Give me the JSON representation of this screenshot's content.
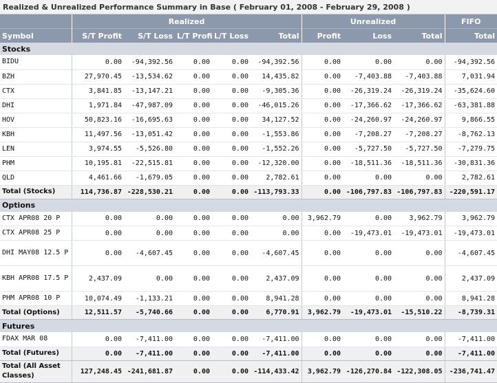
{
  "title": "Realized & Unrealized Performance Summary in Base ( February 01, 2008 - February 29, 2008 )",
  "group_headers": {
    "realized": "Realized",
    "unrealized": "Unrealized",
    "fifo": "FIFO"
  },
  "column_headers": {
    "symbol": "Symbol",
    "st_profit": "S/T Profit",
    "st_loss": "S/T Loss",
    "lt_profit": "L/T Profit",
    "lt_loss": "L/T Loss",
    "realized_total": "Total",
    "profit": "Profit",
    "loss": "Loss",
    "unrealized_total": "Total",
    "fifo_total": "Total"
  },
  "sections": {
    "stocks": {
      "label": "Stocks",
      "rows": [
        {
          "symbol": "BIDU",
          "v": [
            "0.00",
            "-94,392.56",
            "0.00",
            "0.00",
            "-94,392.56",
            "0.00",
            "0.00",
            "0.00",
            "-94,392.56"
          ]
        },
        {
          "symbol": "BZH",
          "v": [
            "27,970.45",
            "-13,534.62",
            "0.00",
            "0.00",
            "14,435.82",
            "0.00",
            "-7,403.88",
            "-7,403.88",
            "7,031.94"
          ]
        },
        {
          "symbol": "CTX",
          "v": [
            "3,841.85",
            "-13,147.21",
            "0.00",
            "0.00",
            "-9,305.36",
            "0.00",
            "-26,319.24",
            "-26,319.24",
            "-35,624.60"
          ]
        },
        {
          "symbol": "DHI",
          "v": [
            "1,971.84",
            "-47,987.09",
            "0.00",
            "0.00",
            "-46,015.26",
            "0.00",
            "-17,366.62",
            "-17,366.62",
            "-63,381.88"
          ]
        },
        {
          "symbol": "HOV",
          "v": [
            "50,823.16",
            "-16,695.63",
            "0.00",
            "0.00",
            "34,127.52",
            "0.00",
            "-24,260.97",
            "-24,260.97",
            "9,866.55"
          ]
        },
        {
          "symbol": "KBH",
          "v": [
            "11,497.56",
            "-13,051.42",
            "0.00",
            "0.00",
            "-1,553.86",
            "0.00",
            "-7,208.27",
            "-7,208.27",
            "-8,762.13"
          ]
        },
        {
          "symbol": "LEN",
          "v": [
            "3,974.55",
            "-5,526.80",
            "0.00",
            "0.00",
            "-1,552.26",
            "0.00",
            "-5,727.50",
            "-5,727.50",
            "-7,279.75"
          ]
        },
        {
          "symbol": "PHM",
          "v": [
            "10,195.81",
            "-22,515.81",
            "0.00",
            "0.00",
            "-12,320.00",
            "0.00",
            "-18,511.36",
            "-18,511.36",
            "-30,831.36"
          ]
        },
        {
          "symbol": "QLD",
          "v": [
            "4,461.66",
            "-1,679.05",
            "0.00",
            "0.00",
            "2,782.61",
            "0.00",
            "0.00",
            "0.00",
            "2,782.61"
          ]
        }
      ],
      "total": {
        "label": "Total (Stocks)",
        "v": [
          "114,736.87",
          "-228,530.21",
          "0.00",
          "0.00",
          "-113,793.33",
          "0.00",
          "-106,797.83",
          "-106,797.83",
          "-220,591.17"
        ]
      }
    },
    "options": {
      "label": "Options",
      "rows": [
        {
          "symbol": "CTX APR08 20 P",
          "v": [
            "0.00",
            "0.00",
            "0.00",
            "0.00",
            "0.00",
            "3,962.79",
            "0.00",
            "3,962.79",
            "3,962.79"
          ]
        },
        {
          "symbol": "CTX APR08 25 P",
          "v": [
            "0.00",
            "0.00",
            "0.00",
            "0.00",
            "0.00",
            "0.00",
            "-19,473.01",
            "-19,473.01",
            "-19,473.01"
          ]
        },
        {
          "symbol": "DHI MAY08 12.5 P",
          "v": [
            "0.00",
            "-4,607.45",
            "0.00",
            "0.00",
            "-4,607.45",
            "0.00",
            "0.00",
            "0.00",
            "-4,607.45"
          ]
        },
        {
          "symbol": "KBH APR08 17.5 P",
          "v": [
            "2,437.09",
            "0.00",
            "0.00",
            "0.00",
            "2,437.09",
            "0.00",
            "0.00",
            "0.00",
            "2,437.09"
          ]
        },
        {
          "symbol": "PHM APR08 10 P",
          "v": [
            "10,074.49",
            "-1,133.21",
            "0.00",
            "0.00",
            "8,941.28",
            "0.00",
            "0.00",
            "0.00",
            "8,941.28"
          ]
        }
      ],
      "total": {
        "label": "Total (Options)",
        "v": [
          "12,511.57",
          "-5,740.66",
          "0.00",
          "0.00",
          "6,770.91",
          "3,962.79",
          "-19,473.01",
          "-15,510.22",
          "-8,739.31"
        ]
      }
    },
    "futures": {
      "label": "Futures",
      "rows": [
        {
          "symbol": "FDAX MAR 08",
          "v": [
            "0.00",
            "-7,411.00",
            "0.00",
            "0.00",
            "-7,411.00",
            "0.00",
            "0.00",
            "0.00",
            "-7,411.00"
          ]
        }
      ],
      "total": {
        "label": "Total (Futures)",
        "v": [
          "0.00",
          "-7,411.00",
          "0.00",
          "0.00",
          "-7,411.00",
          "0.00",
          "0.00",
          "0.00",
          "-7,411.00"
        ]
      }
    }
  },
  "grand_total": {
    "label": "Total (All Asset Classes)",
    "v": [
      "127,248.45",
      "-241,681.87",
      "0.00",
      "0.00",
      "-114,433.42",
      "3,962.79",
      "-126,270.84",
      "-122,308.05",
      "-236,741.47"
    ]
  },
  "colors": {
    "header_bg": "#8c99ad",
    "section_bg": "#d5dae2",
    "total_bg": "#f0f0f0"
  }
}
